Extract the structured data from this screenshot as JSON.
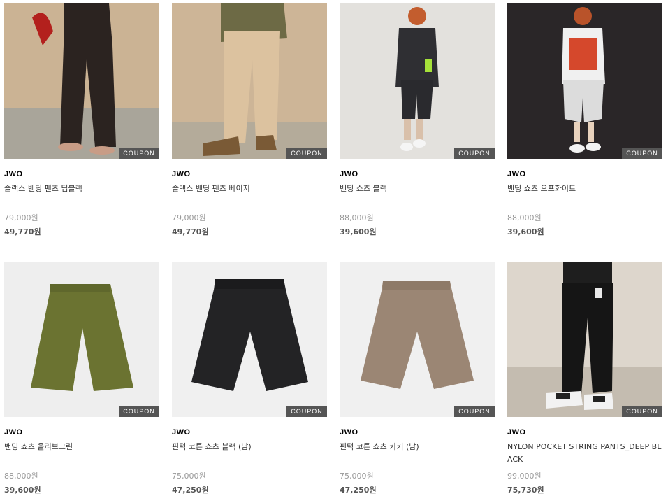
{
  "products": [
    {
      "brand": "JWO",
      "name": "슬랙스 밴딩 팬츠 딥블랙",
      "original_price": "79,000원",
      "sale_price": "49,770원",
      "badge": "COUPON"
    },
    {
      "brand": "JWO",
      "name": "슬랙스 밴딩 팬츠 베이지",
      "original_price": "79,000원",
      "sale_price": "49,770원",
      "badge": "COUPON"
    },
    {
      "brand": "JWO",
      "name": "밴딩 쇼츠 블랙",
      "original_price": "88,000원",
      "sale_price": "39,600원",
      "badge": "COUPON"
    },
    {
      "brand": "JWO",
      "name": "밴딩 쇼츠 오프화이트",
      "original_price": "88,000원",
      "sale_price": "39,600원",
      "badge": "COUPON"
    },
    {
      "brand": "JWO",
      "name": "밴딩 쇼츠 올리브그린",
      "original_price": "88,000원",
      "sale_price": "39,600원",
      "badge": "COUPON"
    },
    {
      "brand": "JWO",
      "name": "핀턱 코튼 쇼츠 블랙 (남)",
      "original_price": "75,000원",
      "sale_price": "47,250원",
      "badge": "COUPON"
    },
    {
      "brand": "JWO",
      "name": "핀턱 코튼 쇼츠 카키 (남)",
      "original_price": "75,000원",
      "sale_price": "47,250원",
      "badge": "COUPON"
    },
    {
      "brand": "JWO",
      "name": "NYLON POCKET STRING PANTS_DEEP BLACK",
      "original_price": "99,000원",
      "sale_price": "75,730원",
      "badge": "COUPON"
    }
  ]
}
